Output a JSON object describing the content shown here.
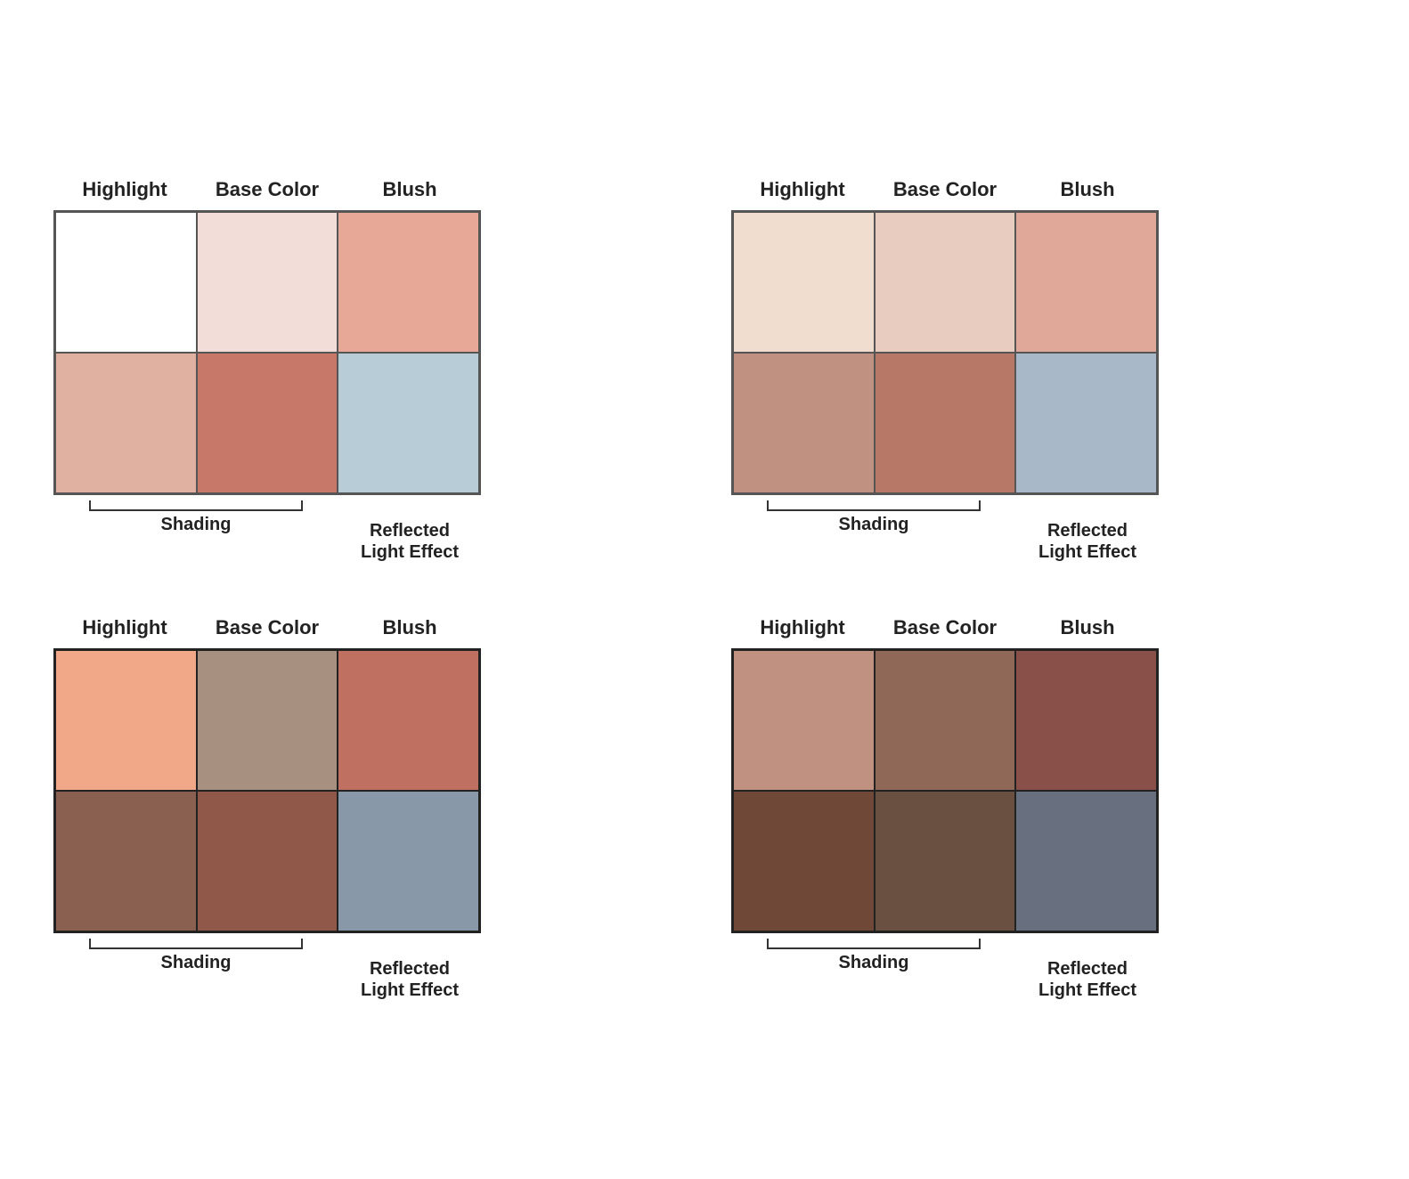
{
  "charts": [
    {
      "id": "chart-1",
      "headers": [
        "Highlight",
        "Base Color",
        "Blush"
      ],
      "cells": [
        {
          "color": "#ffffff",
          "row": 0,
          "col": 0
        },
        {
          "color": "#f0dcd8",
          "row": 0,
          "col": 1
        },
        {
          "color": "#e8a898",
          "row": 0,
          "col": 2
        },
        {
          "color": "#e8b0a0",
          "row": 1,
          "col": 0
        },
        {
          "color": "#c87868",
          "row": 1,
          "col": 1
        },
        {
          "color": "#b8ccd8",
          "row": 1,
          "col": 2
        }
      ],
      "shading_label": "Shading",
      "reflected_label": "Reflected\nLight Effect",
      "border_color": "#555555",
      "dark": false
    },
    {
      "id": "chart-2",
      "headers": [
        "Highlight",
        "Base Color",
        "Blush"
      ],
      "cells": [
        {
          "color": "#f0dcd0",
          "row": 0,
          "col": 0
        },
        {
          "color": "#e8ccc0",
          "row": 0,
          "col": 1
        },
        {
          "color": "#e0a898",
          "row": 0,
          "col": 2
        },
        {
          "color": "#c09080",
          "row": 1,
          "col": 0
        },
        {
          "color": "#b87868",
          "row": 1,
          "col": 1
        },
        {
          "color": "#a8b8c8",
          "row": 1,
          "col": 2
        }
      ],
      "shading_label": "Shading",
      "reflected_label": "Reflected\nLight Effect",
      "border_color": "#555555",
      "dark": false
    },
    {
      "id": "chart-3",
      "headers": [
        "Highlight",
        "Base Color",
        "Blush"
      ],
      "cells": [
        {
          "color": "#f0a888",
          "row": 0,
          "col": 0
        },
        {
          "color": "#b09080",
          "row": 0,
          "col": 1
        },
        {
          "color": "#c07060",
          "row": 0,
          "col": 2
        },
        {
          "color": "#906050",
          "row": 1,
          "col": 0
        },
        {
          "color": "#905848",
          "row": 1,
          "col": 1
        },
        {
          "color": "#8898a8",
          "row": 1,
          "col": 2
        }
      ],
      "shading_label": "Shading",
      "reflected_label": "Reflected\nLight Effect",
      "border_color": "#222222",
      "dark": true
    },
    {
      "id": "chart-4",
      "headers": [
        "Highlight",
        "Base Color",
        "Blush"
      ],
      "cells": [
        {
          "color": "#c09080",
          "row": 0,
          "col": 0
        },
        {
          "color": "#906858",
          "row": 0,
          "col": 1
        },
        {
          "color": "#885048",
          "row": 0,
          "col": 2
        },
        {
          "color": "#704838",
          "row": 1,
          "col": 0
        },
        {
          "color": "#705048",
          "row": 1,
          "col": 1
        },
        {
          "color": "#6870808",
          "row": 1,
          "col": 2
        }
      ],
      "shading_label": "Shading",
      "reflected_label": "Reflected\nLight Effect",
      "border_color": "#222222",
      "dark": true
    }
  ]
}
